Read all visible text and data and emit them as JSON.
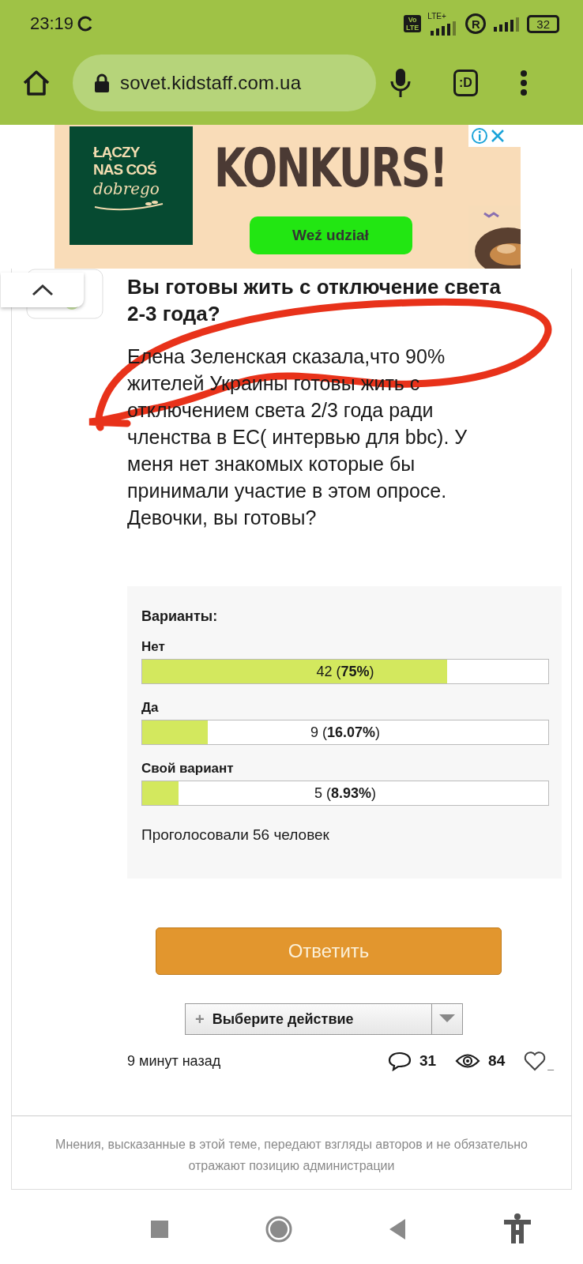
{
  "status_bar": {
    "time": "23:19",
    "volte": [
      "Vo",
      "LTE"
    ],
    "network": "LTE+",
    "roaming": "R",
    "battery": "32"
  },
  "browser": {
    "url": "sovet.kidstaff.com.ua",
    "tab_button": ":D"
  },
  "ad": {
    "logo_lines": [
      "ŁĄCZY",
      "NAS COŚ",
      "dobrego"
    ],
    "headline": "KONKURS!",
    "button": "Weź udział"
  },
  "post": {
    "title": "Вы готовы жить с отключение света 2-3 года?",
    "body": "Елена Зеленская сказала,что 90% жителей Украины готовы жить с отключением света 2/3 года ради членства в ЕС( интервью для bbc). У меня нет знакомых которые бы принимали участие в этом опросе. Девочки, вы готовы?",
    "poll": {
      "heading": "Варианты:",
      "options": [
        {
          "label": "Нет",
          "result": "42 (**75%**)",
          "level": 0.75
        },
        {
          "label": "Да",
          "result": "9 (**16.07%**)",
          "level": 0.1607
        },
        {
          "label": "Свой вариант",
          "result": "5 (**8.93%**)",
          "level": 0.0893
        }
      ],
      "total": "Проголосовали 56 человек"
    },
    "reply_button": "Ответить",
    "action_select": {
      "plus": "+",
      "value": "Выберите действие"
    },
    "time": "9 минут назад",
    "comments": "31",
    "views": "84",
    "likes": "_"
  },
  "disclaimer": "Мнения, высказанные в этой теме, передают взгляды авторов и не обязательно отражают позицию администрации"
}
